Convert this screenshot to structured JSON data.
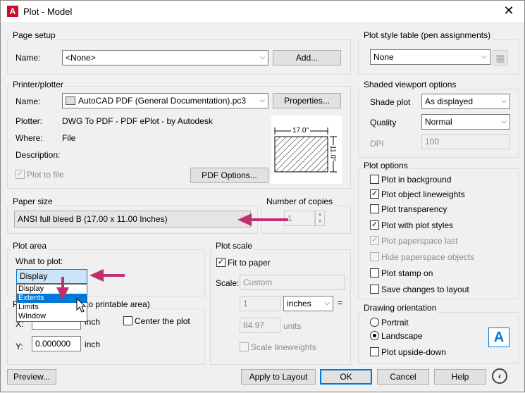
{
  "window": {
    "title": "Plot - Model",
    "app_icon_letter": "A"
  },
  "page_setup": {
    "group_label": "Page setup",
    "name_label": "Name:",
    "name_value": "<None>",
    "add_button": "Add..."
  },
  "printer": {
    "group_label": "Printer/plotter",
    "name_label": "Name:",
    "name_value": "AutoCAD PDF (General Documentation).pc3",
    "properties_button": "Properties...",
    "plotter_label": "Plotter:",
    "plotter_value": "DWG To PDF - PDF ePlot - by Autodesk",
    "where_label": "Where:",
    "where_value": "File",
    "description_label": "Description:",
    "plot_to_file": "Plot to file",
    "pdf_options_button": "PDF Options...",
    "preview_width": "17.0\"",
    "preview_height": "11.0\""
  },
  "paper_size": {
    "group_label": "Paper size",
    "value": "ANSI full bleed B (17.00 x 11.00 Inches)"
  },
  "copies": {
    "group_label": "Number of copies",
    "value": "1"
  },
  "plot_area": {
    "group_label": "Plot area",
    "what_label": "What to plot:",
    "value": "Display",
    "options": [
      "Display",
      "Extents",
      "Limits",
      "Window"
    ]
  },
  "plot_offset": {
    "group_label_tail": "to printable area)",
    "x_label": "X:",
    "y_label": "Y:",
    "y_value": "0.000000",
    "unit": "inch",
    "center_plot": "Center the plot"
  },
  "plot_scale": {
    "group_label": "Plot scale",
    "fit_to_paper": "Fit to paper",
    "scale_label": "Scale:",
    "scale_value": "Custom",
    "num_value": "1",
    "unit_value": "inches",
    "equals": "=",
    "den_value": "84.97",
    "den_unit": "units",
    "scale_lineweights": "Scale lineweights"
  },
  "plot_style_table": {
    "group_label": "Plot style table (pen assignments)",
    "value": "None"
  },
  "shaded_viewport": {
    "group_label": "Shaded viewport options",
    "shade_label": "Shade plot",
    "shade_value": "As displayed",
    "quality_label": "Quality",
    "quality_value": "Normal",
    "dpi_label": "DPI",
    "dpi_value": "100"
  },
  "plot_options": {
    "group_label": "Plot options",
    "items": [
      {
        "label": "Plot in background",
        "checked": false,
        "enabled": true
      },
      {
        "label": "Plot object lineweights",
        "checked": true,
        "enabled": true
      },
      {
        "label": "Plot transparency",
        "checked": false,
        "enabled": true
      },
      {
        "label": "Plot with plot styles",
        "checked": true,
        "enabled": true
      },
      {
        "label": "Plot paperspace last",
        "checked": true,
        "enabled": false
      },
      {
        "label": "Hide paperspace objects",
        "checked": false,
        "enabled": false
      },
      {
        "label": "Plot stamp on",
        "checked": false,
        "enabled": true
      },
      {
        "label": "Save changes to layout",
        "checked": false,
        "enabled": true
      }
    ]
  },
  "orientation": {
    "group_label": "Drawing orientation",
    "portrait": "Portrait",
    "landscape": "Landscape",
    "upside_down": "Plot upside-down",
    "icon_letter": "A"
  },
  "buttons": {
    "preview": "Preview...",
    "apply": "Apply to Layout",
    "ok": "OK",
    "cancel": "Cancel",
    "help": "Help"
  },
  "colors": {
    "arrow": "#c0306e",
    "accent": "#0078d7"
  }
}
